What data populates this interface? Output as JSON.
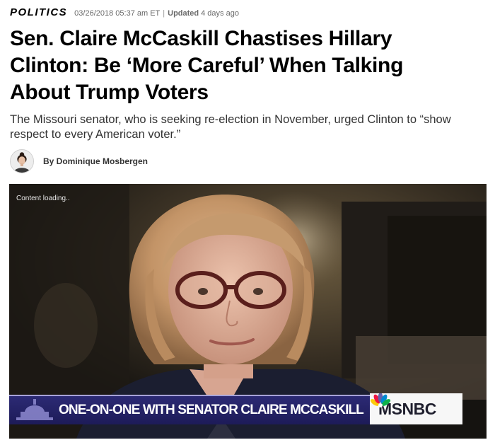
{
  "meta": {
    "section": "POLITICS",
    "date": "03/26/2018 05:37 am ET",
    "separator": "|",
    "updated_label": "Updated",
    "updated_value": "4 days ago"
  },
  "headline": "Sen. Claire McCaskill Chastises Hillary Clinton: Be ‘More Careful’ When Talking About Trump Voters",
  "dek": "The Missouri senator, who is seeking re-election in November, urged Clinton to “show respect to every American voter.”",
  "byline": {
    "text": "By Dominique Mosbergen"
  },
  "video": {
    "loading_text": "Content loading..",
    "lower_third": "ONE-ON-ONE WITH SENATOR CLAIRE MCCASKILL",
    "network": "MSNBC",
    "peacock_colors": [
      "#fccb0a",
      "#ef1541",
      "#6460aa",
      "#0089d0",
      "#0db14b",
      "#f37021"
    ]
  },
  "colors": {
    "lower_third_bg": "#2c2a74",
    "logo_bg": "#f7f7f7"
  }
}
